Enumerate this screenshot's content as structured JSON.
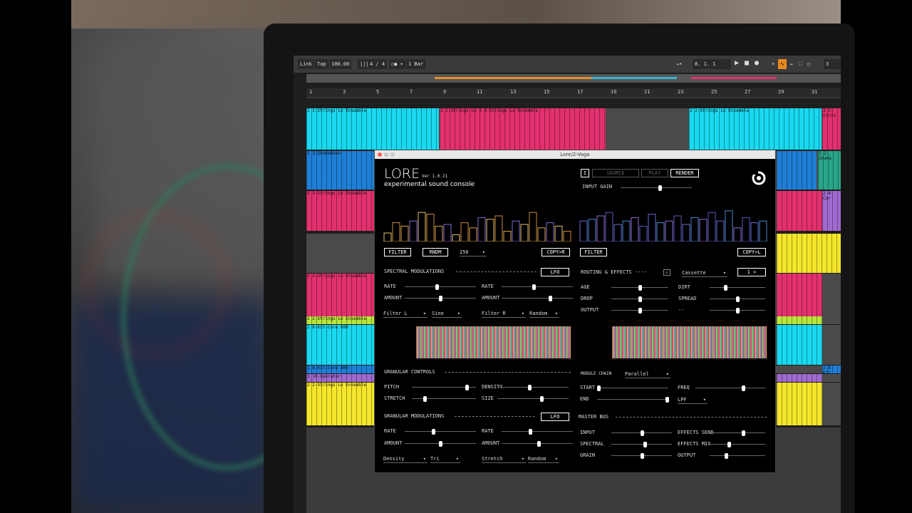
{
  "daw": {
    "link": "Link",
    "tap": "Tap",
    "tempo": "100.00",
    "timesig": "4 / 4",
    "quant": "1 Bar",
    "position": "8.  1.  1",
    "right_num": "3",
    "ruler": [
      "1",
      "3",
      "5",
      "7",
      "9",
      "11",
      "13",
      "15",
      "17",
      "19",
      "21",
      "23",
      "25",
      "27",
      "29",
      "31"
    ],
    "clips": [
      "2 2-Strings Lo Ensemble",
      "3 2-Strings Lo  3 2-Strings Lo Ensemble",
      "2 2-Strings Lo Ensemble",
      "3 2-Strin",
      "1 2-ShakeDown",
      "1 2-Shake",
      "2 2-Strings Lo Ensemble",
      "2 4-Car",
      "2 2-Strings Lo Ensemble",
      "2 2-Strings Lo Ensemble",
      "1 8-Kit-Core 808",
      "1 8-Kit-Core 808",
      "1 8-Kit",
      "1 10-Operator",
      "2 2-Strings Lo Ensemble"
    ],
    "colors": {
      "cyan": "#19d9f0",
      "magenta": "#e3306f",
      "blue": "#1f7fd6",
      "yellow": "#f4e62a",
      "purple": "#a06ad0",
      "green": "#2aa58a",
      "lime": "#b8e63a"
    }
  },
  "plugin": {
    "window_title": "Lore/2-Voga",
    "title": "LORE",
    "version": "Ver 1.0.21",
    "subtitle": "experimental sound console",
    "toggle": "I",
    "source": "SOURCE",
    "play": "PLAY",
    "render": "RENDER",
    "input_gain": "INPUT GAIN",
    "input_gain_value": 0.55,
    "filter": "FILTER",
    "rndm": "RNDM",
    "bands": "256",
    "copy_r": "COPY>R",
    "filter2": "FILTER",
    "copy_l": "COPY>L",
    "spectral_modulations": "SPECTRAL MODULATIONS",
    "lfo": "LFO",
    "spec_left": {
      "rate": "RATE",
      "amount": "AMOUNT",
      "rate_v": 0.45,
      "amount_v": 0.5,
      "target": "Filter L",
      "shape": "Sine"
    },
    "spec_right": {
      "rate": "RATE",
      "amount": "AMOUNT",
      "rate_v": 0.45,
      "amount_v": 0.68,
      "target": "Filter R",
      "shape": "Random"
    },
    "routing": "ROUTING & EFFECTS ----",
    "cassette": "Cassette",
    "next": "1 >",
    "fx": [
      {
        "label": "AGE",
        "v": 0.5
      },
      {
        "label": "DROP",
        "v": 0.5
      },
      {
        "label": "OUTPUT",
        "v": 0.5
      },
      {
        "label": "DIRT",
        "v": 0.28
      },
      {
        "label": "SPREAD",
        "v": 0.5
      },
      {
        "label": "--",
        "v": 0.5
      }
    ],
    "granular_controls": "GRANULAR CONTROLS",
    "gran": [
      {
        "label": "PITCH",
        "v": 0.85
      },
      {
        "label": "STRETCH",
        "v": 0.2
      },
      {
        "label": "DENSITY",
        "v": 0.45
      },
      {
        "label": "SIZE",
        "v": 0.62
      }
    ],
    "module_chain": "MODULE CHAIN",
    "chain": "Parallel",
    "chain_ctrl": [
      {
        "label": "START",
        "v": 0.02
      },
      {
        "label": "END",
        "v": 0.98
      },
      {
        "label": "FREQ",
        "v": 0.68
      }
    ],
    "filter_type": "LPF",
    "granular_modulations": "GRANULAR MODULATIONS",
    "lfo2": "LFO",
    "gm_left": {
      "rate": "RATE",
      "amount": "AMOUNT",
      "rate_v": 0.4,
      "amount_v": 0.5,
      "target": "Density",
      "shape": "Tri"
    },
    "gm_right": {
      "rate": "RATE",
      "amount": "AMOUNT",
      "rate_v": 0.4,
      "amount_v": 0.52,
      "target": "Stretch",
      "shape": "Random"
    },
    "master_bus": "MASTER BUS",
    "master": [
      {
        "label": "INPUT",
        "v": 0.5
      },
      {
        "label": "SPECTRAL",
        "v": 0.55
      },
      {
        "label": "GRAIN",
        "v": 0.5
      },
      {
        "label": "EFFECTS SEND",
        "v": 0.6
      },
      {
        "label": "EFFECTS MIX",
        "v": 0.35
      },
      {
        "label": "OUTPUT",
        "v": 0.3
      }
    ],
    "bars_left": [
      0.25,
      0.55,
      0.45,
      0.6,
      0.85,
      0.8,
      0.45,
      0.5,
      0.2,
      0.55,
      0.4,
      0.7,
      0.65,
      0.75,
      0.3,
      0.6,
      0.5,
      0.85,
      0.4,
      0.55,
      0.45,
      0.3
    ],
    "bars_right": [
      0.6,
      0.65,
      0.75,
      0.85,
      0.5,
      0.6,
      0.7,
      0.45,
      0.8,
      0.55,
      0.6,
      0.75,
      0.5,
      0.7,
      0.65,
      0.85,
      0.6,
      0.9,
      0.4,
      0.7,
      0.55,
      0.6
    ]
  }
}
